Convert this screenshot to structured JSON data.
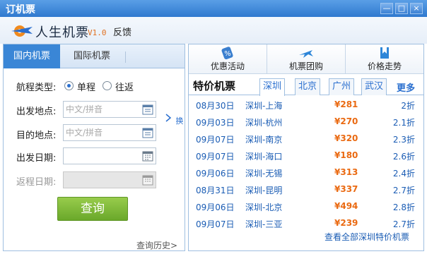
{
  "window": {
    "title": "订机票",
    "buttons": [
      "—",
      "□",
      "×"
    ]
  },
  "app": {
    "name": "人生机票",
    "version": "V1.0",
    "feedback": "反馈"
  },
  "left": {
    "tabs": [
      {
        "label": "国内机票",
        "active": true
      },
      {
        "label": "国际机票",
        "active": false
      }
    ],
    "trip_type_label": "航程类型:",
    "trip_oneway": "单程",
    "trip_round": "往返",
    "depart_label": "出发地点:",
    "depart_placeholder": "中文/拼音",
    "arrive_label": "目的地点:",
    "arrive_placeholder": "中文/拼音",
    "swap_label": "换",
    "date_label": "出发日期:",
    "return_label": "返程日期:",
    "search_label": "查询",
    "history_label": "查询历史>"
  },
  "toolbar": [
    {
      "label": "优惠活动",
      "icon": "coupon-icon"
    },
    {
      "label": "机票团购",
      "icon": "plane-icon"
    },
    {
      "label": "价格走势",
      "icon": "bookmark-icon"
    }
  ],
  "special": {
    "title": "特价机票",
    "cities": [
      {
        "label": "深圳",
        "active": true
      },
      {
        "label": "北京",
        "active": false
      },
      {
        "label": "广州",
        "active": false
      },
      {
        "label": "武汉",
        "active": false
      }
    ],
    "more": "更多",
    "rows": [
      {
        "date": "08月30日",
        "route": "深圳-上海",
        "price": "¥281",
        "discount": "2折"
      },
      {
        "date": "09月03日",
        "route": "深圳-杭州",
        "price": "¥270",
        "discount": "2.1折"
      },
      {
        "date": "09月07日",
        "route": "深圳-南京",
        "price": "¥320",
        "discount": "2.3折"
      },
      {
        "date": "09月07日",
        "route": "深圳-海口",
        "price": "¥180",
        "discount": "2.6折"
      },
      {
        "date": "09月06日",
        "route": "深圳-无锡",
        "price": "¥313",
        "discount": "2.4折"
      },
      {
        "date": "08月31日",
        "route": "深圳-昆明",
        "price": "¥337",
        "discount": "2.7折"
      },
      {
        "date": "09月06日",
        "route": "深圳-北京",
        "price": "¥494",
        "discount": "2.8折"
      },
      {
        "date": "09月07日",
        "route": "深圳-三亚",
        "price": "¥239",
        "discount": "2.7折"
      }
    ],
    "view_all": "查看全部深圳特价机票"
  },
  "colors": {
    "accent": "#3a86d6",
    "price": "#ea6a12",
    "search": "#7cb83a"
  }
}
